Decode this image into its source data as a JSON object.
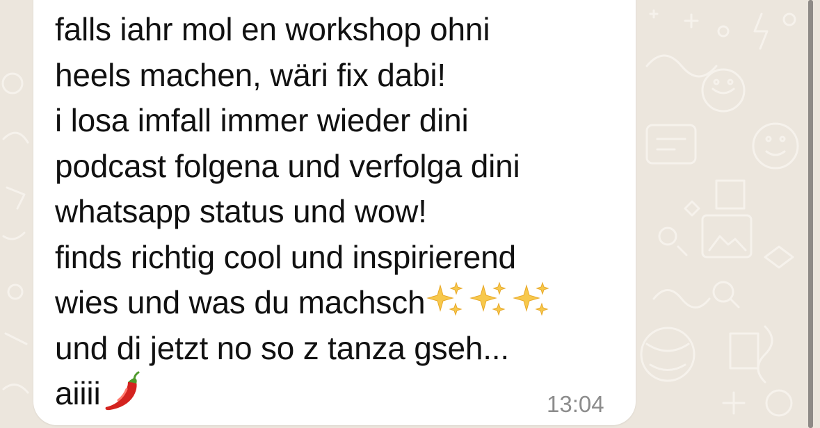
{
  "chat": {
    "background_color": "#ece6dd",
    "bubble_color": "#ffffff",
    "message": {
      "lines": [
        "falls iahr mol en workshop ohni",
        "heels machen, wäri fix dabi!",
        "i losa imfall immer wieder dini",
        "podcast folgena und verfolga dini",
        "whatsapp status und wow!",
        "finds richtig cool und inspirierend",
        "wies und was du machsch",
        "und di jetzt no so z tanza gseh...",
        "aiiii"
      ],
      "emojis": {
        "line_7": [
          "sparkles-icon",
          "sparkles-icon",
          "sparkles-icon"
        ],
        "line_9": [
          "hot-pepper-icon"
        ]
      },
      "time": "13:04"
    }
  }
}
